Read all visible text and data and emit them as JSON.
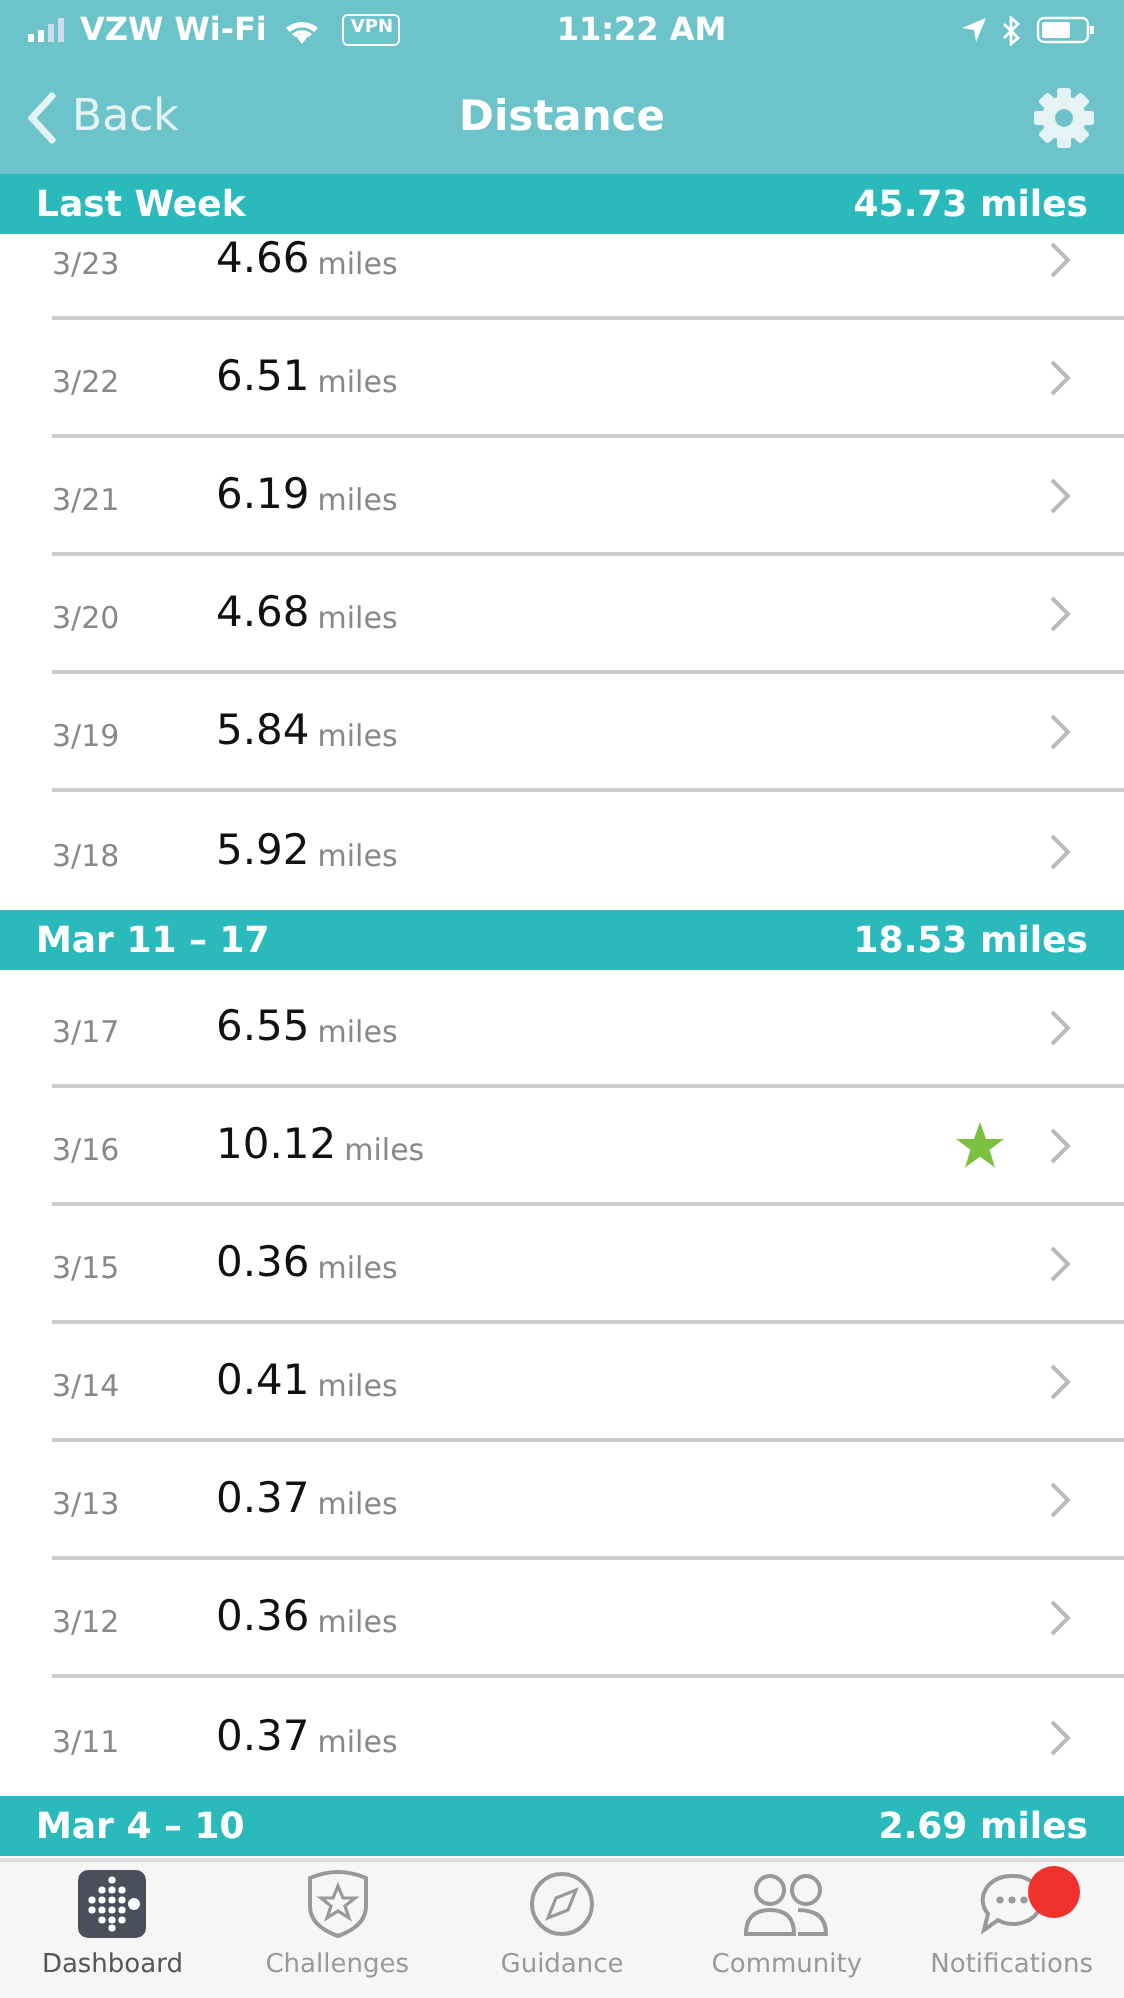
{
  "status_bar": {
    "carrier": "VZW Wi-Fi",
    "vpn": "VPN",
    "time": "11:22 AM"
  },
  "nav": {
    "back": "Back",
    "title": "Distance"
  },
  "sections": [
    {
      "title": "Last Week",
      "total": "45.73 miles",
      "rows": [
        {
          "date": "3/23",
          "value": "4.66",
          "unit": "miles",
          "starred": false
        },
        {
          "date": "3/22",
          "value": "6.51",
          "unit": "miles",
          "starred": false
        },
        {
          "date": "3/21",
          "value": "6.19",
          "unit": "miles",
          "starred": false
        },
        {
          "date": "3/20",
          "value": "4.68",
          "unit": "miles",
          "starred": false
        },
        {
          "date": "3/19",
          "value": "5.84",
          "unit": "miles",
          "starred": false
        },
        {
          "date": "3/18",
          "value": "5.92",
          "unit": "miles",
          "starred": false
        }
      ]
    },
    {
      "title": "Mar 11 – 17",
      "total": "18.53 miles",
      "rows": [
        {
          "date": "3/17",
          "value": "6.55",
          "unit": "miles",
          "starred": false
        },
        {
          "date": "3/16",
          "value": "10.12",
          "unit": "miles",
          "starred": true
        },
        {
          "date": "3/15",
          "value": "0.36",
          "unit": "miles",
          "starred": false
        },
        {
          "date": "3/14",
          "value": "0.41",
          "unit": "miles",
          "starred": false
        },
        {
          "date": "3/13",
          "value": "0.37",
          "unit": "miles",
          "starred": false
        },
        {
          "date": "3/12",
          "value": "0.36",
          "unit": "miles",
          "starred": false
        },
        {
          "date": "3/11",
          "value": "0.37",
          "unit": "miles",
          "starred": false
        }
      ]
    },
    {
      "title": "Mar 4 – 10",
      "total": "2.69 miles"
    }
  ],
  "tab_bar": [
    {
      "label": "Dashboard",
      "kind": "dashboard",
      "selected": true,
      "badge": false
    },
    {
      "label": "Challenges",
      "kind": "challenges",
      "selected": false,
      "badge": false
    },
    {
      "label": "Guidance",
      "kind": "guidance",
      "selected": false,
      "badge": false
    },
    {
      "label": "Community",
      "kind": "community",
      "selected": false,
      "badge": false
    },
    {
      "label": "Notifications",
      "kind": "notifications",
      "selected": false,
      "badge": true
    }
  ]
}
